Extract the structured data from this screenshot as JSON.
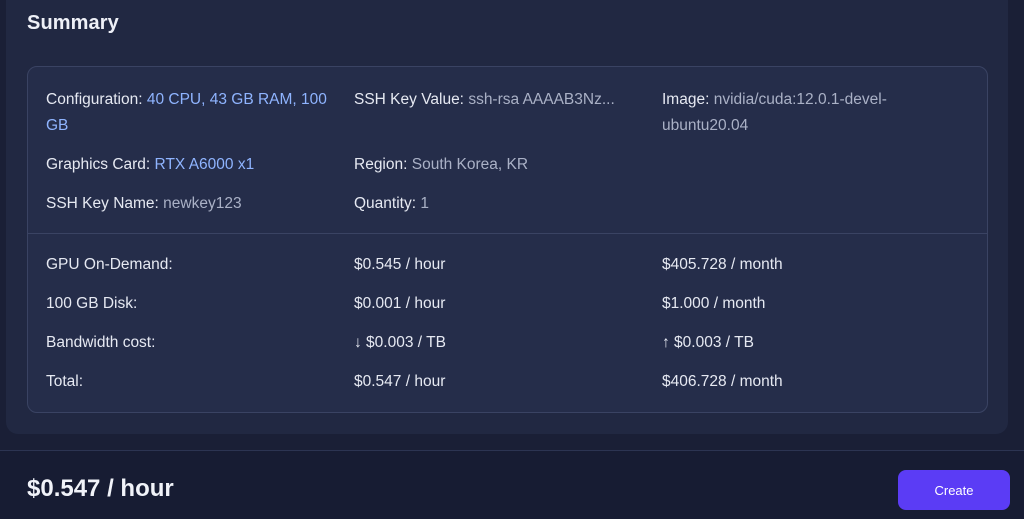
{
  "panel": {
    "title": "Summary"
  },
  "config": {
    "configuration": {
      "label": "Configuration:",
      "value": "40 CPU, 43 GB RAM, 100 GB"
    },
    "graphics_card": {
      "label": "Graphics Card:",
      "value": "RTX A6000 x1"
    },
    "ssh_key_name": {
      "label": "SSH Key Name:",
      "value": "newkey123"
    },
    "ssh_key_value": {
      "label": "SSH Key Value:",
      "value": "ssh-rsa AAAAB3Nz..."
    },
    "region": {
      "label": "Region:",
      "value": "South Korea, KR"
    },
    "quantity": {
      "label": "Quantity:",
      "value": "1"
    },
    "image": {
      "label": "Image:",
      "value": "nvidia/cuda:12.0.1-devel-ubuntu20.04"
    }
  },
  "costs": [
    {
      "label": "GPU On-Demand:",
      "hourly": "$0.545 / hour",
      "monthly": "$405.728 / month"
    },
    {
      "label": "100 GB Disk:",
      "hourly": "$0.001 / hour",
      "monthly": "$1.000 / month"
    },
    {
      "label": "Bandwidth cost:",
      "hourly": "↓ $0.003 / TB",
      "monthly": "↑ $0.003 / TB"
    },
    {
      "label": "Total:",
      "hourly": "$0.547 / hour",
      "monthly": "$406.728 / month"
    }
  ],
  "footer": {
    "total_price": "$0.547 / hour",
    "create_label": "Create"
  },
  "colors": {
    "accent": "#8fb4ff",
    "button": "#5b3cf5",
    "background": "#1a1f36"
  }
}
